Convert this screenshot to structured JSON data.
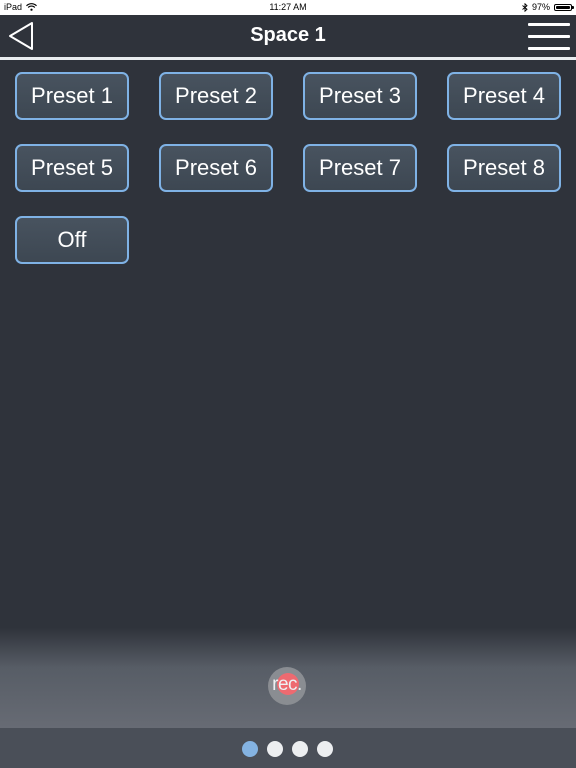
{
  "status_bar": {
    "device": "iPad",
    "time": "11:27 AM",
    "battery_percent": "97%",
    "battery_level": 0.97,
    "icons": [
      "wifi-icon",
      "bluetooth-icon",
      "battery-icon"
    ]
  },
  "nav": {
    "title": "Space 1",
    "back_icon": "back-arrow-icon",
    "menu_icon": "hamburger-menu-icon"
  },
  "presets": [
    {
      "label": "Preset 1"
    },
    {
      "label": "Preset 2"
    },
    {
      "label": "Preset 3"
    },
    {
      "label": "Preset 4"
    },
    {
      "label": "Preset 5"
    },
    {
      "label": "Preset 6"
    },
    {
      "label": "Preset 7"
    },
    {
      "label": "Preset 8"
    },
    {
      "label": "Off"
    }
  ],
  "record": {
    "label": "rec."
  },
  "pager": {
    "count": 4,
    "active_index": 0
  },
  "colors": {
    "background": "#2f333b",
    "button_border": "#7fb2e5",
    "active_dot": "#84b3e2",
    "rec_dot": "#ee6a70"
  }
}
